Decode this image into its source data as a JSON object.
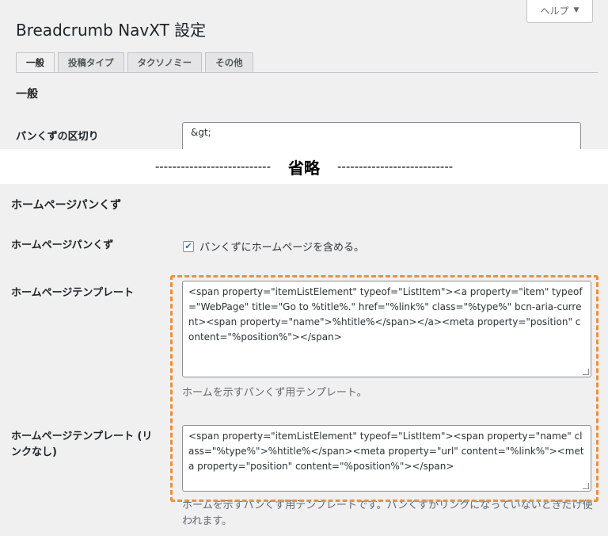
{
  "header": {
    "help_label": "ヘルプ",
    "title": "Breadcrumb NavXT 設定"
  },
  "tabs": [
    {
      "label": "一般"
    },
    {
      "label": "投稿タイプ"
    },
    {
      "label": "タクソノミー"
    },
    {
      "label": "その他"
    }
  ],
  "general": {
    "heading": "一般",
    "separator_label": "パンくずの区切り",
    "separator_value": "&gt;"
  },
  "omitted": {
    "dashes_left": "---------------------------",
    "text": "省略",
    "dashes_right": "---------------------------"
  },
  "home": {
    "heading": "ホームページパンくず",
    "include_label": "ホームページパンくず",
    "include_checkbox_label": "パンくずにホームページを含める。",
    "include_checked": true,
    "template_label": "ホームページテンプレート",
    "template_value": "<span property=\"itemListElement\" typeof=\"ListItem\"><a property=\"item\" typeof=\"WebPage\" title=\"Go to %title%.\" href=\"%link%\" class=\"%type%\" bcn-aria-current><span property=\"name\">%htitle%</span></a><meta property=\"position\" content=\"%position%\"></span>",
    "template_desc": "ホームを示すパンくず用テンプレート。",
    "template_nolink_label": "ホームページテンプレート (リンクなし)",
    "template_nolink_value": "<span property=\"itemListElement\" typeof=\"ListItem\"><span property=\"name\" class=\"%type%\">%htitle%</span><meta property=\"url\" content=\"%link%\"><meta property=\"position\" content=\"%position%\"></span>",
    "template_nolink_desc": "ホームを示すパンくず用テンプレートです。パンくずがリンクになっていないときだけ使われます。"
  },
  "colors": {
    "highlight": "#e8913a",
    "panel_bg": "#f0f0f1"
  }
}
